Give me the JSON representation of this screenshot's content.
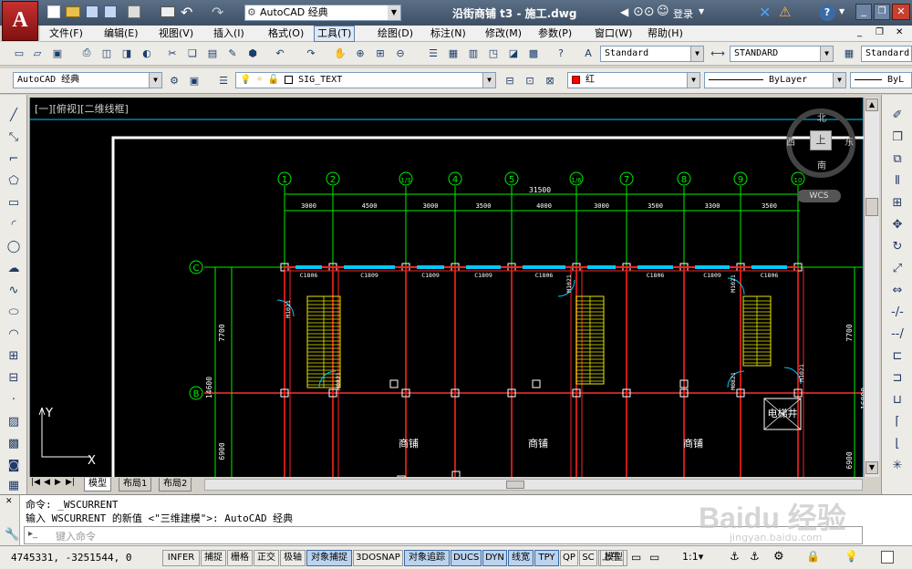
{
  "window": {
    "title": "沿街商铺 t3 - 施工.dwg",
    "workspace": "AutoCAD 经典",
    "login_label": "登录",
    "help_label": "?"
  },
  "menu": [
    "文件(F)",
    "编辑(E)",
    "视图(V)",
    "插入(I)",
    "格式(O)",
    "工具(T)",
    "绘图(D)",
    "标注(N)",
    "修改(M)",
    "参数(P)",
    "窗口(W)",
    "帮助(H)"
  ],
  "active_menu": "工具(T)",
  "styles": {
    "text_style": "Standard",
    "dim_style": "STANDARD",
    "table_style": "Standard"
  },
  "layers_bar": {
    "workspace": "AutoCAD 经典",
    "layer": "SIG_TEXT",
    "color_label": "红",
    "linetype": "ByLayer",
    "lineweight": "ByL"
  },
  "viewport": {
    "label": "[一][俯视][二维线框]",
    "compass": {
      "north": "北",
      "south": "南",
      "east": "东",
      "west": "西",
      "top": "上"
    },
    "ucs_label": "WCS"
  },
  "drawing": {
    "grid_labels": [
      "1",
      "2",
      "1/3",
      "4",
      "5",
      "1/6",
      "7",
      "8",
      "9",
      "10"
    ],
    "total_dim": "31500",
    "span_dims": [
      "3000",
      "4500",
      "3000",
      "3500",
      "4000",
      "3000",
      "3500",
      "3300",
      "3500"
    ],
    "row_labels": [
      "C",
      "B"
    ],
    "window_tags": [
      "C1806",
      "C1809",
      "C1809",
      "C1809",
      "C1806",
      "C1806",
      "C1809",
      "C1806"
    ],
    "door_tags": [
      "M1021",
      "M0821",
      "M1021",
      "M0821",
      "M1021",
      "M1021"
    ],
    "side_dims_left": [
      "7700",
      "14600",
      "6900"
    ],
    "side_dims_right": [
      "7700",
      "16800",
      "6900"
    ],
    "room_labels": [
      "商铺",
      "商铺",
      "商铺"
    ],
    "elevator_label": "电梯井",
    "ucs_axis_x": "X",
    "ucs_axis_y": "Y"
  },
  "layout_tabs": [
    "模型",
    "布局1",
    "布局2"
  ],
  "command": {
    "history": [
      "命令: _WSCURRENT",
      "输入 WSCURRENT 的新值 <\"三维建模\">: AutoCAD 经典"
    ],
    "prompt_placeholder": "键入命令"
  },
  "status": {
    "coords": "4745331, -3251544, 0",
    "toggles": [
      {
        "label": "INFER",
        "on": false
      },
      {
        "label": "捕捉",
        "on": false
      },
      {
        "label": "栅格",
        "on": false
      },
      {
        "label": "正交",
        "on": false
      },
      {
        "label": "极轴",
        "on": false
      },
      {
        "label": "对象捕捉",
        "on": true
      },
      {
        "label": "3DOSNAP",
        "on": false
      },
      {
        "label": "对象追踪",
        "on": true
      },
      {
        "label": "DUCS",
        "on": true
      },
      {
        "label": "DYN",
        "on": true
      },
      {
        "label": "线宽",
        "on": true
      },
      {
        "label": "TPY",
        "on": true
      },
      {
        "label": "QP",
        "on": false
      },
      {
        "label": "SC",
        "on": false
      },
      {
        "label": "上午",
        "on": false
      }
    ],
    "model_label": "模型",
    "scale_label": "1:1"
  },
  "watermark": {
    "line1": "Baidu 经验",
    "line2": "jingyan.baidu.com"
  },
  "colors": {
    "canvas_bg": "#000000",
    "grid_axis": "#00cc00",
    "wall": "#ff2020",
    "stair": "#e8e800",
    "window": "#00c8ff",
    "accent": "#3b6aa5"
  }
}
